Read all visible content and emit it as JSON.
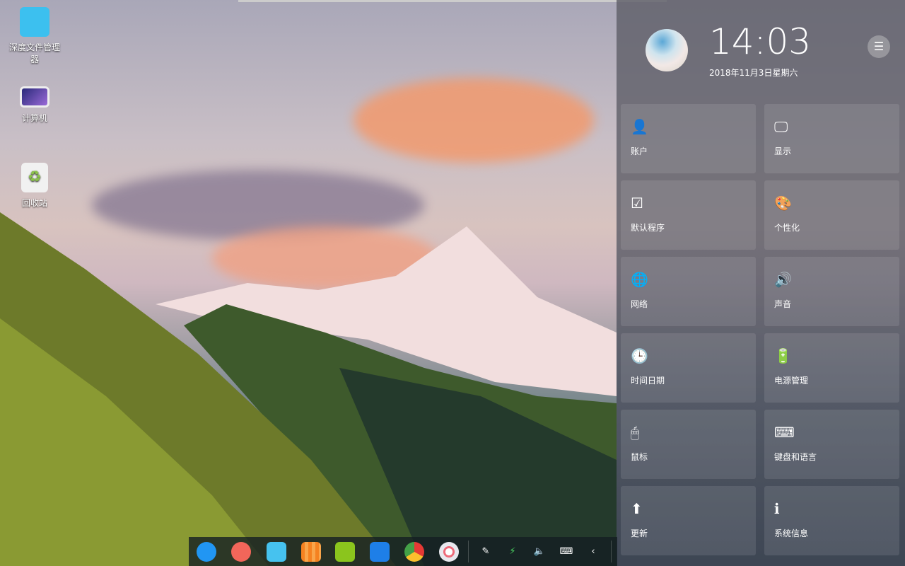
{
  "desktop": {
    "icons": [
      {
        "label": "深度文件管理器"
      },
      {
        "label": "计算机"
      },
      {
        "label": "回收站"
      }
    ]
  },
  "control_center": {
    "time": "14:03",
    "date": "2018年11月3日星期六",
    "menu_icon": "☰",
    "tiles": [
      {
        "label": "账户",
        "icon": "👤"
      },
      {
        "label": "显示",
        "icon": "🖵"
      },
      {
        "label": "默认程序",
        "icon": "☑"
      },
      {
        "label": "个性化",
        "icon": "🎨"
      },
      {
        "label": "网络",
        "icon": "🌐"
      },
      {
        "label": "声音",
        "icon": "🔊"
      },
      {
        "label": "时间日期",
        "icon": "🕒"
      },
      {
        "label": "电源管理",
        "icon": "🔋"
      },
      {
        "label": "鼠标",
        "icon": "🖱"
      },
      {
        "label": "键盘和语言",
        "icon": "⌨"
      },
      {
        "label": "更新",
        "icon": "⬆"
      },
      {
        "label": "系统信息",
        "icon": "ℹ"
      }
    ]
  },
  "dock": {
    "apps": [
      "launcher",
      "screen-recorder",
      "file-manager",
      "app-store",
      "music",
      "movie",
      "chrome",
      "control-center"
    ],
    "tray": [
      {
        "icon": "✎"
      },
      {
        "icon": "⚡"
      },
      {
        "icon": "🔈"
      },
      {
        "icon": "⌨"
      },
      {
        "icon": "‹"
      }
    ]
  }
}
